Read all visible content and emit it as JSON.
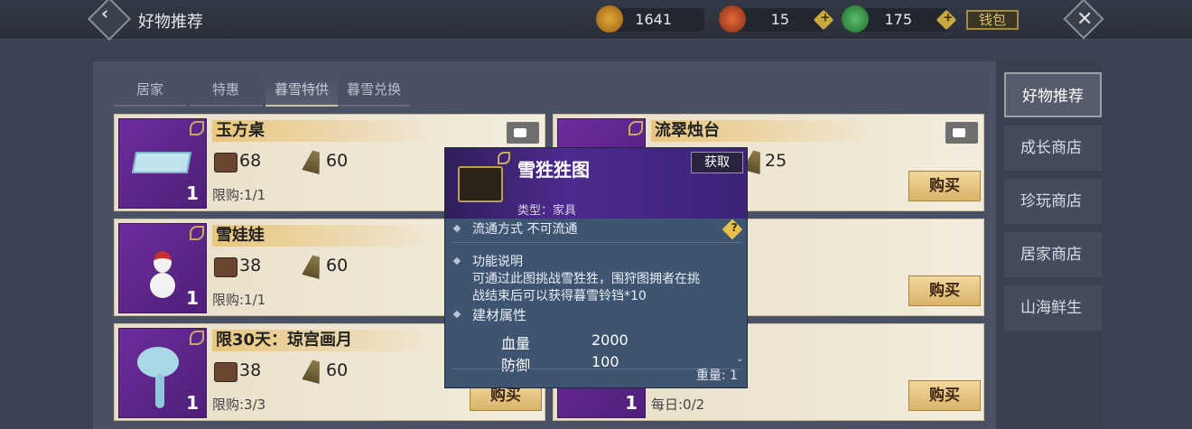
{
  "header": {
    "back_icon": "back-arrow-icon",
    "title": "好物推荐",
    "currencies": [
      {
        "value": "1641",
        "icon": "gold-coin-icon",
        "color": "#c08a2a"
      },
      {
        "value": "15",
        "icon": "red-jade-icon",
        "color": "#c44a2a"
      },
      {
        "value": "175",
        "icon": "green-jade-icon",
        "color": "#3a9a4a"
      }
    ],
    "wallet_label": "钱包",
    "close_icon": "close-icon"
  },
  "tabs": [
    "居家",
    "特惠",
    "暮雪特供",
    "暮雪兑换"
  ],
  "active_tab": "暮雪特供",
  "cards_left": [
    {
      "name": "玉方桌",
      "qty": "1",
      "price1": "68",
      "price2": "60",
      "limit": "限购:1/1"
    },
    {
      "name": "雪娃娃",
      "qty": "1",
      "price1": "38",
      "price2": "60",
      "limit": "限购:1/1"
    },
    {
      "name": "限30天：琼宫画月",
      "qty": "1",
      "price1": "38",
      "price2": "60",
      "limit": "限购:3/3"
    }
  ],
  "cards_right": [
    {
      "name": "流翠烛台",
      "price2": "25"
    },
    {
      "qty": "1",
      "limit": "每日:0/2"
    }
  ],
  "buy_label": "购买",
  "sidebar": [
    "好物推荐",
    "成长商店",
    "珍玩商店",
    "居家商店",
    "山海鲜生"
  ],
  "popup": {
    "name": "雪狌狌图",
    "get_label": "获取",
    "type": "类型：家具",
    "circulation": "流通方式   不可流通",
    "func_title": "功能说明",
    "func_desc1": "可通过此图挑战雪狌狌，围狩图拥者在挑",
    "func_desc2": "战结束后可以获得暮雪铃铛*10",
    "attr_title": "建材属性",
    "hp_label": "血量",
    "hp_value": "2000",
    "def_label": "防御",
    "def_value": "100",
    "weight": "重量: 1"
  }
}
